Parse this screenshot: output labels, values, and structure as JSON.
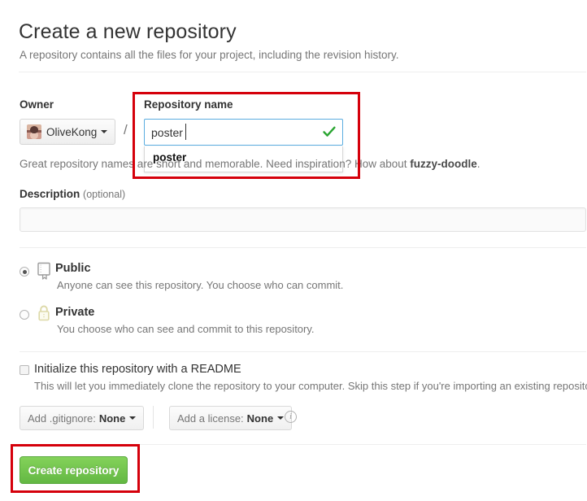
{
  "header": {
    "title": "Create a new repository",
    "subtitle": "A repository contains all the files for your project, including the revision history."
  },
  "owner": {
    "label": "Owner",
    "name": "OliveKong",
    "separator": "/",
    "avatar_icon": "user-avatar-icon",
    "caret_icon": "chevron-down-icon"
  },
  "repo_name": {
    "label": "Repository name",
    "value": "poster",
    "placeholder": "",
    "valid_icon": "green-check-icon",
    "valid_color": "#2aa531",
    "autocomplete": {
      "items": [
        "poster"
      ]
    }
  },
  "hint": {
    "prefix": "Great repository names are short and memorable. Need inspiration? How about ",
    "suggestion": "fuzzy-doodle",
    "suffix": "."
  },
  "description": {
    "label": "Description",
    "optional": "(optional)",
    "value": "",
    "placeholder": ""
  },
  "visibility": {
    "options": [
      {
        "id": "public",
        "title": "Public",
        "description": "Anyone can see this repository. You choose who can commit.",
        "selected": true,
        "icon": "repo-book-icon"
      },
      {
        "id": "private",
        "title": "Private",
        "description": "You choose who can see and commit to this repository.",
        "selected": false,
        "icon": "lock-icon"
      }
    ]
  },
  "readme": {
    "label": "Initialize this repository with a README",
    "description": "This will let you immediately clone the repository to your computer. Skip this step if you're importing an existing repository.",
    "checked": false
  },
  "gitignore": {
    "label": "Add .gitignore:",
    "value": "None",
    "caret_icon": "chevron-down-icon"
  },
  "license": {
    "label": "Add a license:",
    "value": "None",
    "caret_icon": "chevron-down-icon",
    "info_icon": "info-circle-icon",
    "info_glyph": "i"
  },
  "submit": {
    "label": "Create repository",
    "color": "#6cc644"
  },
  "annotations": {
    "color": "#d5000b",
    "boxes": [
      "repository-name-field",
      "create-repository-button"
    ]
  }
}
